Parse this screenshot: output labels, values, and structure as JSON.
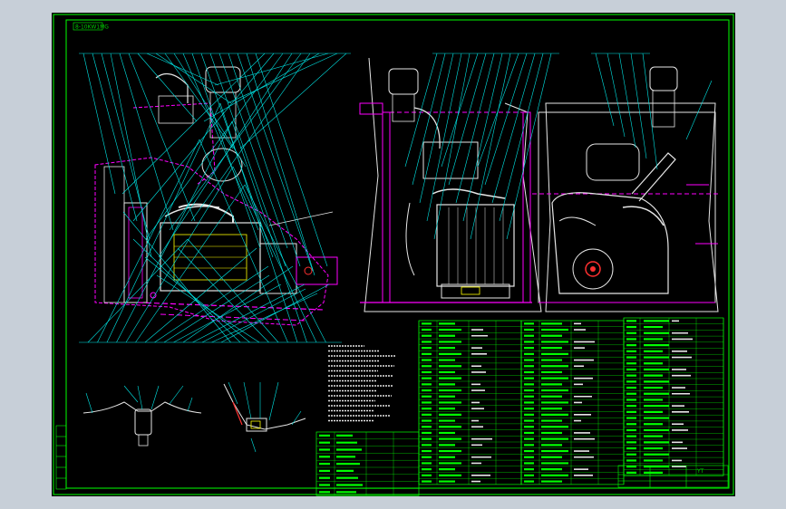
{
  "colors": {
    "background": "#c7cfd8",
    "paper": "#000000",
    "border": "#00ff00",
    "leader_cyan": "#00e5e5",
    "outline_magenta": "#ff00ff",
    "part_white": "#e6e6e6",
    "part_yellow": "#ffff00",
    "part_red": "#ff3030",
    "table_green": "#00ff00"
  },
  "drawing": {
    "title_tag": "8-10KW1MG",
    "sheet_label": "YT"
  }
}
